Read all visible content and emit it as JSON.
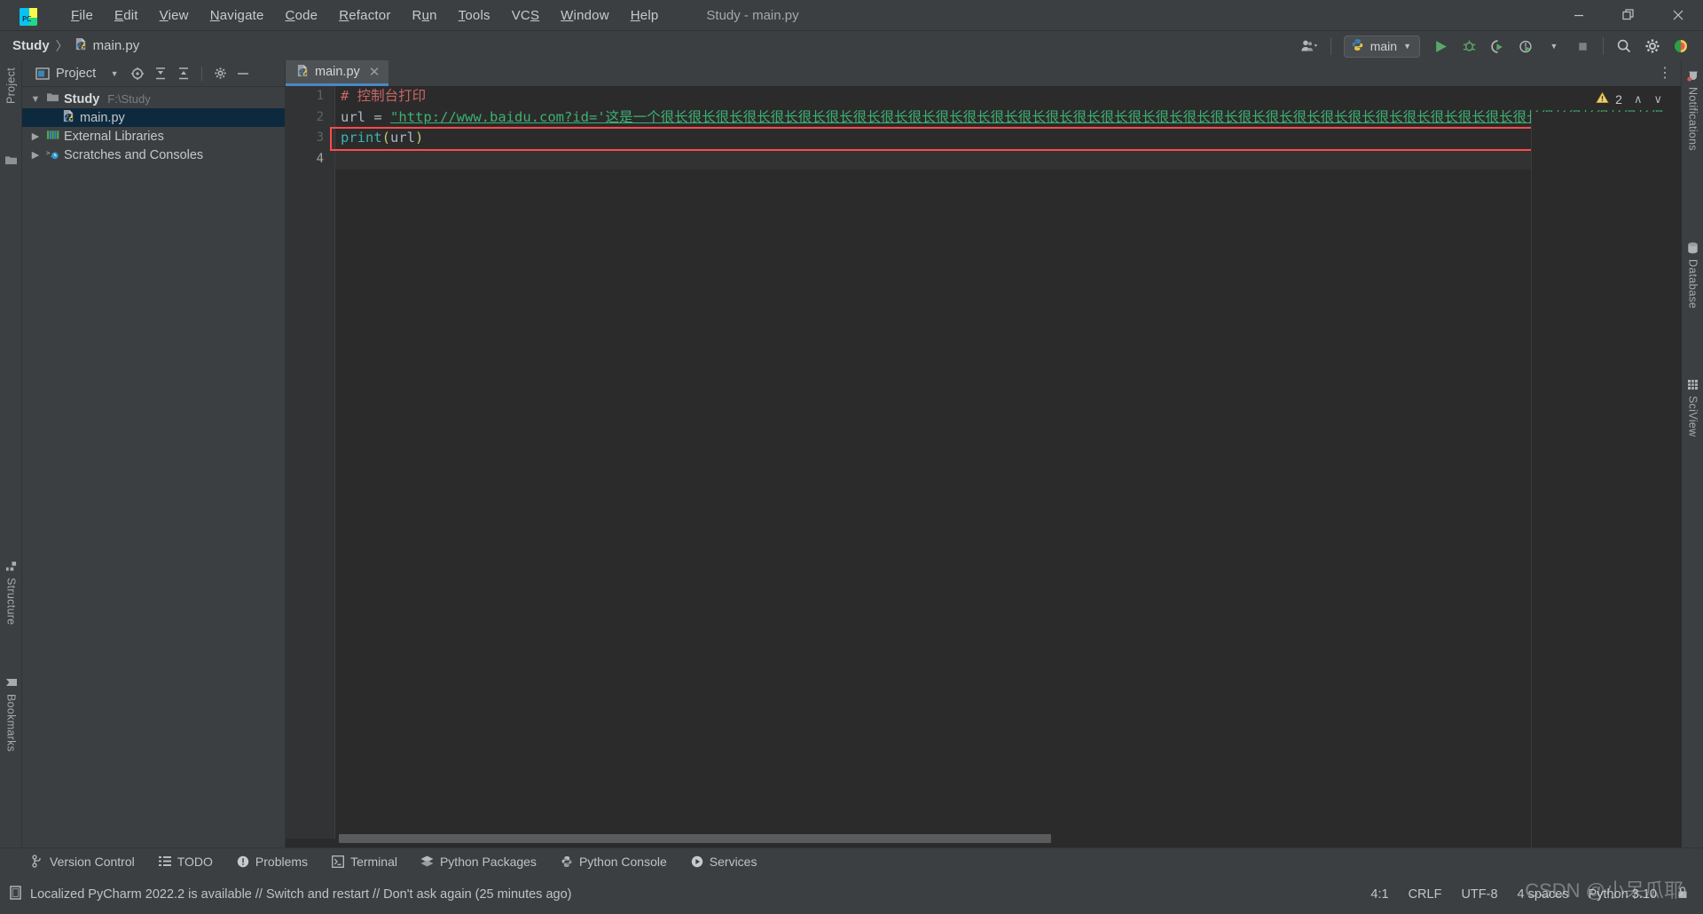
{
  "window": {
    "title": "Study - main.py",
    "app_icon": "pycharm-logo-icon",
    "controls": {
      "minimize": "—",
      "maximize": "❐",
      "close": "✕"
    }
  },
  "menu": {
    "items": [
      {
        "label": "File",
        "mnemonic": "F"
      },
      {
        "label": "Edit",
        "mnemonic": "E"
      },
      {
        "label": "View",
        "mnemonic": "V"
      },
      {
        "label": "Navigate",
        "mnemonic": "N"
      },
      {
        "label": "Code",
        "mnemonic": "C"
      },
      {
        "label": "Refactor",
        "mnemonic": "R"
      },
      {
        "label": "Run",
        "mnemonic": "u"
      },
      {
        "label": "Tools",
        "mnemonic": "T"
      },
      {
        "label": "VCS",
        "mnemonic": "S"
      },
      {
        "label": "Window",
        "mnemonic": "W"
      },
      {
        "label": "Help",
        "mnemonic": "H"
      }
    ]
  },
  "navbar": {
    "breadcrumb": {
      "project": "Study",
      "separator": "〉",
      "file": "main.py"
    },
    "run_config": {
      "label": "main",
      "icon": "python-icon",
      "chevron": "▼"
    },
    "account_icon": "user-account-icon",
    "buttons": [
      {
        "name": "run-button",
        "glyph": "▶"
      },
      {
        "name": "debug-button",
        "glyph": "debug-bug-icon"
      },
      {
        "name": "run-coverage-button",
        "glyph": "coverage-icon"
      },
      {
        "name": "profile-button",
        "glyph": "profiler-icon"
      },
      {
        "name": "stop-button",
        "glyph": "■"
      },
      {
        "name": "search-everywhere-button",
        "glyph": "search-icon"
      },
      {
        "name": "settings-button",
        "glyph": "gear-icon"
      },
      {
        "name": "ide-assistant-button",
        "glyph": "assistant-icon"
      }
    ]
  },
  "left_stripe": {
    "top_label": "Project",
    "bottom_labels": [
      "Structure",
      "Bookmarks"
    ]
  },
  "right_stripe": {
    "labels": [
      "Notifications",
      "Database",
      "SciView"
    ]
  },
  "project_panel": {
    "header": {
      "title": "Project",
      "chevron": "▼",
      "icons": [
        "select-opened-file-icon",
        "expand-all-icon",
        "collapse-all-icon",
        "gear-icon",
        "hide-icon"
      ]
    },
    "tree": [
      {
        "arrow": "∨",
        "icon": "folder-icon",
        "label": "Study",
        "path": "F:\\Study",
        "bold": true,
        "indent": 0,
        "selected": false
      },
      {
        "arrow": "",
        "icon": "python-file-icon",
        "label": "main.py",
        "path": "",
        "bold": false,
        "indent": 1,
        "selected": true
      },
      {
        "arrow": "›",
        "icon": "library-icon",
        "label": "External Libraries",
        "path": "",
        "bold": false,
        "indent": 0,
        "selected": false
      },
      {
        "arrow": "›",
        "icon": "scratches-icon",
        "label": "Scratches and Consoles",
        "path": "",
        "bold": false,
        "indent": 0,
        "selected": false
      }
    ]
  },
  "editor": {
    "tab": {
      "label": "main.py",
      "icon": "python-file-icon",
      "close": "✕"
    },
    "more_button": "⋮",
    "line_numbers": [
      "1",
      "2",
      "3",
      "4"
    ],
    "current_line": "4",
    "lines": [
      {
        "n": 1,
        "tokens": [
          {
            "t": "comment",
            "v": "# 控制台打印"
          }
        ]
      },
      {
        "n": 2,
        "tokens": [
          {
            "t": "var",
            "v": "url"
          },
          {
            "t": "plain",
            "v": " "
          },
          {
            "t": "op",
            "v": "="
          },
          {
            "t": "plain",
            "v": " "
          },
          {
            "t": "str",
            "v": "\"http://www.baidu.com?id='这是一个很长很长很长很长很长很长很长很长很长很长很长很长很长很长很长很长很长很长很长很长很长很长很长很长很长很长很长很长很长很长很长很长很长很长很长很长很"
          }
        ]
      },
      {
        "n": 3,
        "tokens": [
          {
            "t": "fn",
            "v": "print"
          },
          {
            "t": "paren",
            "v": "("
          },
          {
            "t": "var",
            "v": "url"
          },
          {
            "t": "paren",
            "v": ")"
          }
        ]
      },
      {
        "n": 4,
        "tokens": []
      }
    ],
    "inspection": {
      "warning_glyph": "⚠",
      "warning_count": "2",
      "up": "∧",
      "down": "∨"
    },
    "error_highlight_line": 2
  },
  "tool_window_bar": {
    "items": [
      {
        "label": "Version Control",
        "icon": "branch-icon"
      },
      {
        "label": "TODO",
        "icon": "list-icon"
      },
      {
        "label": "Problems",
        "icon": "exclamation-circle-icon"
      },
      {
        "label": "Terminal",
        "icon": "terminal-icon"
      },
      {
        "label": "Python Packages",
        "icon": "packages-icon"
      },
      {
        "label": "Python Console",
        "icon": "python-console-icon"
      },
      {
        "label": "Services",
        "icon": "services-play-icon"
      }
    ]
  },
  "status_bar": {
    "icon": "notification-doc-icon",
    "message": "Localized PyCharm 2022.2 is available // Switch and restart // Don't ask again (25 minutes ago)",
    "right": {
      "caret": "4:1",
      "line_separator": "CRLF",
      "encoding": "UTF-8",
      "indent": "4 spaces",
      "interpreter": "Python 3.10",
      "lock_icon": "lock-icon"
    }
  },
  "watermark": {
    "text": "CSDN @小呆瓜耶"
  },
  "colors": {
    "bg_chrome": "#3c3f41",
    "bg_editor": "#2b2b2b",
    "gutter": "#313335",
    "selection_blue": "#0d293e",
    "tab_active_underline": "#4a88c7",
    "string_green": "#3cb173",
    "comment_red": "#cc6666",
    "error_red": "#ff4b4b",
    "function_teal": "#3cb2b2"
  }
}
